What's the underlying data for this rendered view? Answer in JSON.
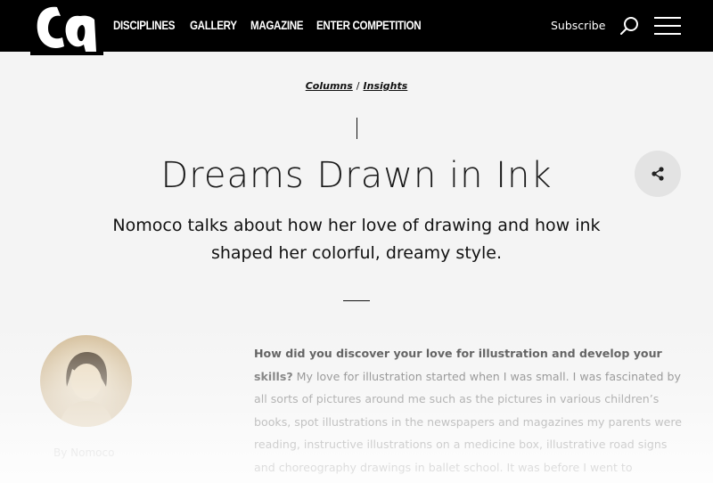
{
  "header": {
    "logo_text": "ca",
    "nav": [
      "DISCIPLINES",
      "GALLERY",
      "MAGAZINE",
      "ENTER COMPETITION"
    ],
    "subscribe_label": "Subscribe"
  },
  "breadcrumb": {
    "items": [
      "Columns",
      "Insights"
    ],
    "separator": "/"
  },
  "article": {
    "title": "Dreams Drawn in Ink",
    "subtitle": "Nomoco talks about how her love of drawing and how ink shaped her colorful, dreamy style.",
    "byline": "By Nomoco",
    "question": "How did you discover your love for illustration and develop your skills?",
    "answer": "My love for illustration started when I was small. I was fascinated by all sorts of pictures around me such as the pictures in various children’s books, spot illustrations in the newspapers and magazines my parents were reading, instructive illustrations on a medicine box, illustrative road signs and choreography drawings in ballet school. It was before I went to elementary"
  },
  "colors": {
    "header_bg": "#000000",
    "page_bg": "#f4f4f4",
    "share_bg": "#e3e3e3"
  }
}
